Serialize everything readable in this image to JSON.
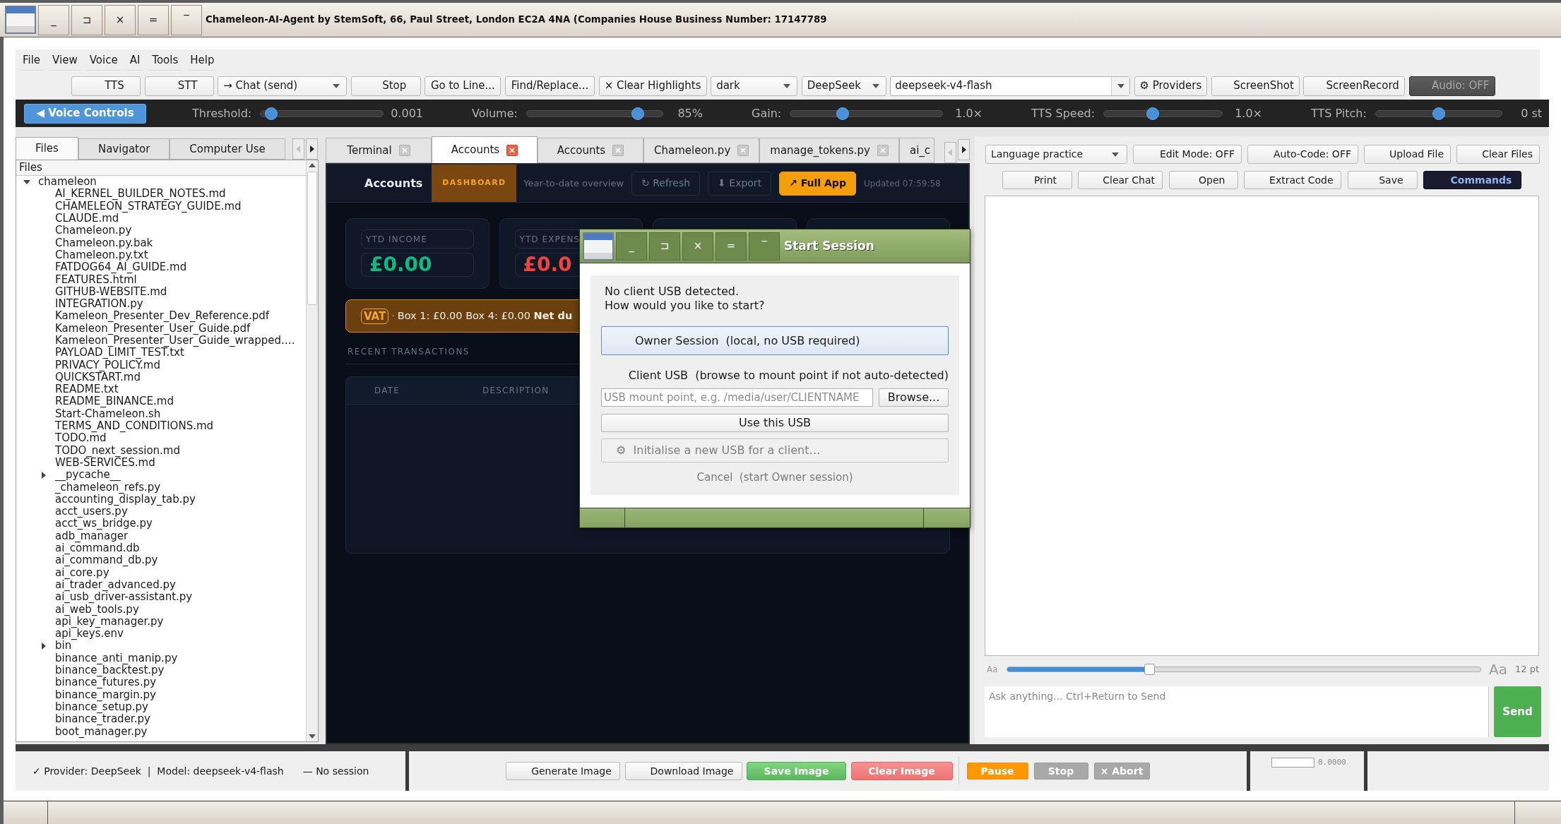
{
  "window": {
    "title": "Chameleon-AI-Agent by StemSoft, 66, Paul Street, London EC2A 4NA (Companies House Business Number: 17147789",
    "controls": [
      "_",
      "⊐",
      "×",
      "=",
      "‾"
    ]
  },
  "menu": [
    "File",
    "View",
    "Voice",
    "AI",
    "Tools",
    "Help"
  ],
  "toolbar": [
    {
      "kind": "button",
      "label": "TTS"
    },
    {
      "kind": "button",
      "label": "STT"
    },
    {
      "kind": "dropdown",
      "label": "→ Chat (send)"
    },
    {
      "kind": "button",
      "label": "Stop"
    },
    {
      "kind": "button",
      "label": "Go to Line..."
    },
    {
      "kind": "button",
      "label": "Find/Replace..."
    },
    {
      "kind": "button",
      "label": "× Clear Highlights"
    },
    {
      "kind": "dropdown",
      "label": "dark"
    },
    {
      "kind": "dropdown",
      "label": "DeepSeek"
    },
    {
      "kind": "entry",
      "value": "deepseek-v4-flash"
    },
    {
      "kind": "button",
      "label": "⚙ Providers"
    },
    {
      "kind": "button",
      "label": "ScreenShot"
    },
    {
      "kind": "button",
      "label": "ScreenRecord"
    },
    {
      "kind": "toggle",
      "label": "Audio: OFF",
      "on": false
    }
  ],
  "voice_bar": {
    "toggle": "◀ Voice Controls",
    "sliders": [
      {
        "label": "Threshold:",
        "level": 0.04,
        "reading": "0.001"
      },
      {
        "label": "Volume:",
        "level": 0.85,
        "reading": "85%"
      },
      {
        "label": "Gain:",
        "level": 0.33,
        "reading": "1.0×"
      },
      {
        "label": "TTS Speed:",
        "level": 0.4,
        "reading": "1.0×"
      },
      {
        "label": "TTS Pitch:",
        "level": 0.5,
        "reading": "0 st"
      }
    ]
  },
  "files_panel": {
    "tabs": [
      {
        "label": "Files",
        "selected": true
      },
      {
        "label": "Navigator",
        "selected": false
      },
      {
        "label": "Computer Use",
        "selected": false
      }
    ],
    "tab_scroll": {
      "back_disabled": true,
      "forward_disabled": false
    },
    "header": "Files",
    "tree": [
      {
        "kind": "folder",
        "name": "chameleon",
        "expanded": true,
        "children": [
          {
            "kind": "file",
            "name": "AI_KERNEL_BUILDER_NOTES.md"
          },
          {
            "kind": "file",
            "name": "CHAMELEON_STRATEGY_GUIDE.md"
          },
          {
            "kind": "file",
            "name": "CLAUDE.md"
          },
          {
            "kind": "file",
            "name": "Chameleon.py"
          },
          {
            "kind": "file",
            "name": "Chameleon.py.bak"
          },
          {
            "kind": "file",
            "name": "Chameleon.py.txt"
          },
          {
            "kind": "file",
            "name": "FATDOG64_AI_GUIDE.md"
          },
          {
            "kind": "file",
            "name": "FEATURES.html"
          },
          {
            "kind": "file",
            "name": "GITHUB-WEBSITE.md"
          },
          {
            "kind": "file",
            "name": "INTEGRATION.py"
          },
          {
            "kind": "file",
            "name": "Kameleon_Presenter_Dev_Reference.pdf"
          },
          {
            "kind": "file",
            "name": "Kameleon_Presenter_User_Guide.pdf"
          },
          {
            "kind": "file",
            "name": "Kameleon_Presenter_User_Guide_wrapped.…"
          },
          {
            "kind": "file",
            "name": "PAYLOAD_LIMIT_TEST.txt"
          },
          {
            "kind": "file",
            "name": "PRIVACY_POLICY.md"
          },
          {
            "kind": "file",
            "name": "QUICKSTART.md"
          },
          {
            "kind": "file",
            "name": "README.txt"
          },
          {
            "kind": "file",
            "name": "README_BINANCE.md"
          },
          {
            "kind": "file",
            "name": "Start-Chameleon.sh"
          },
          {
            "kind": "file",
            "name": "TERMS_AND_CONDITIONS.md"
          },
          {
            "kind": "file",
            "name": "TODO.md"
          },
          {
            "kind": "file",
            "name": "TODO_next_session.md"
          },
          {
            "kind": "file",
            "name": "WEB-SERVICES.md"
          },
          {
            "kind": "folder",
            "name": "__pycache__",
            "expanded": false
          },
          {
            "kind": "file",
            "name": "_chameleon_refs.py"
          },
          {
            "kind": "file",
            "name": "accounting_display_tab.py"
          },
          {
            "kind": "file",
            "name": "acct_users.py"
          },
          {
            "kind": "file",
            "name": "acct_ws_bridge.py"
          },
          {
            "kind": "file",
            "name": "adb_manager"
          },
          {
            "kind": "file",
            "name": "ai_command.db"
          },
          {
            "kind": "file",
            "name": "ai_command_db.py"
          },
          {
            "kind": "file",
            "name": "ai_core.py"
          },
          {
            "kind": "file",
            "name": "ai_trader_advanced.py"
          },
          {
            "kind": "file",
            "name": "ai_usb_driver-assistant.py"
          },
          {
            "kind": "file",
            "name": "ai_web_tools.py"
          },
          {
            "kind": "file",
            "name": "api_key_manager.py"
          },
          {
            "kind": "file",
            "name": "api_keys.env"
          },
          {
            "kind": "folder",
            "name": "bin",
            "expanded": false
          },
          {
            "kind": "file",
            "name": "binance_anti_manip.py"
          },
          {
            "kind": "file",
            "name": "binance_backtest.py"
          },
          {
            "kind": "file",
            "name": "binance_futures.py"
          },
          {
            "kind": "file",
            "name": "binance_margin.py"
          },
          {
            "kind": "file",
            "name": "binance_setup.py"
          },
          {
            "kind": "file",
            "name": "binance_trader.py"
          },
          {
            "kind": "file",
            "name": "boot_manager.py"
          }
        ]
      }
    ]
  },
  "editor": {
    "tabs": [
      {
        "label": "Terminal",
        "selected": false,
        "closable": true
      },
      {
        "label": "Accounts",
        "selected": true,
        "closable": true
      },
      {
        "label": "Accounts",
        "selected": false,
        "closable": true
      },
      {
        "label": "Chameleon.py",
        "selected": false,
        "closable": true
      },
      {
        "label": "manage_tokens.py",
        "selected": false,
        "closable": true
      },
      {
        "label": "ai_c",
        "selected": false,
        "closable": false
      }
    ],
    "tab_scroll": {
      "back_disabled": true,
      "forward_disabled": false
    },
    "accounts": {
      "title": "Accounts",
      "section": "DASHBOARD",
      "subtitle": "Year-to-date overview",
      "actions": [
        {
          "kind": "outline",
          "label": "↻ Refresh"
        },
        {
          "kind": "outline",
          "label": "⬇ Export"
        },
        {
          "kind": "primary",
          "label": "↗ Full App"
        }
      ],
      "updated": "Updated 07:59:58",
      "cards": [
        {
          "kind": "stat",
          "label": "YTD INCOME",
          "value": "£0.00",
          "color": "#10b981"
        },
        {
          "kind": "stat",
          "label": "YTD EXPENS",
          "value": "£0.0",
          "color": "#ef4444"
        },
        {
          "kind": "empty"
        },
        {
          "kind": "empty"
        }
      ],
      "vat": {
        "tag": "VAT",
        "separator": "·",
        "text": "Box 1: £0.00 Box 4: £0.00 **Net du**"
      },
      "recent": {
        "title": "RECENT TRANSACTIONS",
        "columns": [
          "DATE",
          "DESCRIPTION"
        ]
      }
    }
  },
  "chat_panel": {
    "mode": "Language practice",
    "buttons": [
      "Edit Mode: OFF",
      "Auto-Code: OFF",
      "Upload File",
      "Clear Files"
    ],
    "actions": [
      {
        "kind": "plain",
        "label": "Print"
      },
      {
        "kind": "plain",
        "label": "Clear Chat"
      },
      {
        "kind": "plain",
        "label": "Open"
      },
      {
        "kind": "plain",
        "label": "Extract Code"
      },
      {
        "kind": "plain",
        "label": "Save"
      },
      {
        "kind": "dark",
        "label": "Commands"
      }
    ],
    "font_size": {
      "small": "Aa",
      "large": "Aa",
      "level": 0.3,
      "reading": "12 pt"
    },
    "input": {
      "placeholder": "Ask anything... Ctrl+Return to Send"
    },
    "send": "Send"
  },
  "status_bar": {
    "provider": "✓ Provider: DeepSeek  |  Model: deepseek-v4-flash",
    "session": "— No session",
    "image_buttons": [
      {
        "kind": "plain",
        "label": "Generate Image"
      },
      {
        "kind": "plain",
        "label": "Download Image"
      },
      {
        "kind": "success",
        "label": "Save Image"
      },
      {
        "kind": "danger",
        "label": "Clear Image"
      }
    ],
    "run_buttons": [
      {
        "kind": "warning",
        "label": "Pause"
      },
      {
        "kind": "muted",
        "label": "Stop"
      },
      {
        "kind": "muted",
        "label": "× Abort"
      }
    ],
    "counter": "0.0000"
  },
  "dialog": {
    "title": "Start Session",
    "controls": [
      "_",
      "⊐",
      "×",
      "=",
      "‾"
    ],
    "message": "No client USB detected.\nHow would you like to start?",
    "owner_button": "Owner Session  (local, no USB required)",
    "client_label": "Client USB  (browse to mount point if not auto-detected)",
    "mount_field": {
      "placeholder": "USB mount point, e.g. /media/user/CLIENTNAME"
    },
    "browse_button": "Browse...",
    "use_button": "Use this USB",
    "init_button": {
      "label": "⚙  Initialise a new USB for a client…",
      "disabled": true
    },
    "cancel": "Cancel  (start Owner session)"
  }
}
